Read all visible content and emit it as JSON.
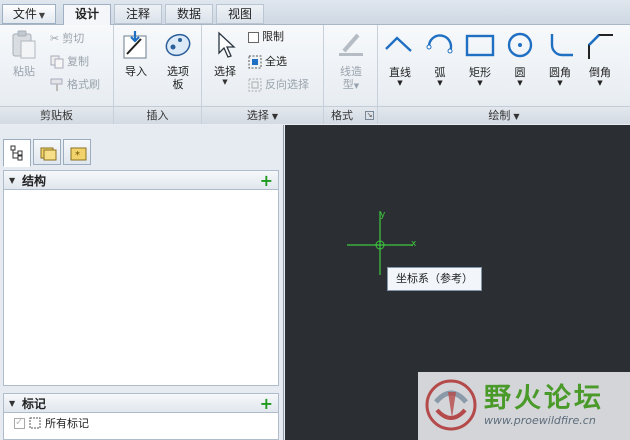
{
  "tabs": {
    "file": "文件",
    "design": "设计",
    "annotate": "注释",
    "data": "数据",
    "view": "视图"
  },
  "ribbon": {
    "clipboard": {
      "label": "剪贴板",
      "paste": "粘贴",
      "cut": "剪切",
      "copy": "复制",
      "format_painter": "格式刷"
    },
    "insert": {
      "label": "插入",
      "import": "导入",
      "palette_line1": "选项",
      "palette_line2": "板"
    },
    "select": {
      "label": "选择",
      "select": "选择",
      "constrain": "限制",
      "select_all": "全选",
      "invert_selection": "反向选择"
    },
    "format": {
      "label": "格式",
      "line_style_line1": "线造",
      "line_style_line2": "型"
    },
    "draw": {
      "label": "绘制",
      "line": "直线",
      "arc": "弧",
      "rectangle": "矩形",
      "circle": "圆",
      "fillet": "圆角",
      "chamfer": "倒角"
    }
  },
  "left_panel": {
    "structure": "结构",
    "markers": "标记",
    "all_markers": "所有标记"
  },
  "canvas": {
    "axis_x": "x",
    "axis_y": "y",
    "tooltip": "坐标系（参考）"
  },
  "watermark": {
    "title": "野火论坛",
    "url": "www.proewildfire.cn"
  },
  "colors": {
    "canvas_bg": "#2b2f33",
    "axis": "#3ec83e",
    "accent_blue": "#1f6fc2",
    "add_green": "#1e9a1e"
  }
}
